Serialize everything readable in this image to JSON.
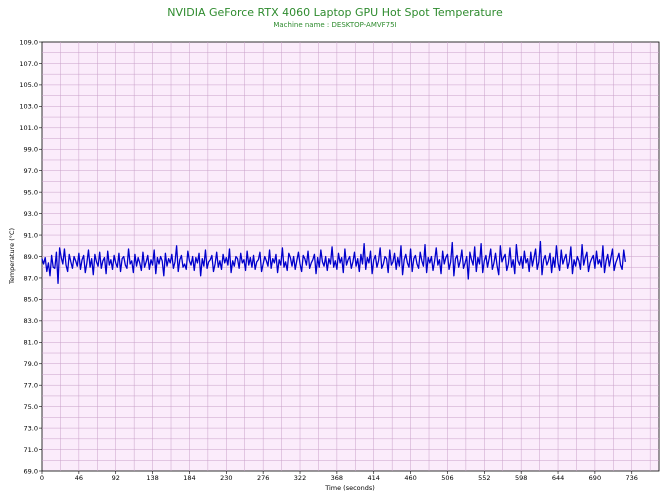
{
  "chart_data": {
    "type": "line",
    "title": "NVIDIA GeForce RTX 4060 Laptop GPU Hot Spot Temperature",
    "subtitle": "Machine name : DESKTOP-AMVF75I",
    "xlabel": "Time (seconds)",
    "ylabel": "Temperature (°C)",
    "xlim": [
      0,
      770
    ],
    "ylim": [
      69.0,
      109.0
    ],
    "x_ticks": [
      "0",
      "46",
      "92",
      "138",
      "184",
      "230",
      "276",
      "322",
      "368",
      "414",
      "460",
      "506",
      "552",
      "598",
      "644",
      "690",
      "736"
    ],
    "y_ticks": [
      "69.0",
      "71.0",
      "73.0",
      "75.0",
      "77.0",
      "79.0",
      "81.0",
      "83.0",
      "85.0",
      "87.0",
      "89.0",
      "91.0",
      "93.0",
      "95.0",
      "97.0",
      "99.0",
      "101.0",
      "103.0",
      "105.0",
      "107.0",
      "109.0"
    ],
    "grid": true,
    "series": [
      {
        "color": "#0000cc",
        "x_start": 0,
        "x_step": 2,
        "values": [
          88.8,
          88.3,
          88.9,
          87.6,
          88.4,
          87.2,
          89.1,
          88.0,
          87.9,
          89.4,
          86.5,
          89.8,
          88.9,
          88.3,
          89.7,
          88.2,
          87.6,
          89.2,
          88.5,
          87.9,
          89.0,
          88.6,
          88.1,
          89.3,
          87.8,
          88.7,
          89.1,
          87.5,
          88.4,
          89.6,
          88.0,
          88.8,
          87.3,
          89.2,
          88.5,
          88.1,
          89.4,
          87.9,
          88.6,
          88.9,
          87.4,
          89.5,
          88.2,
          88.7,
          87.8,
          89.1,
          88.4,
          88.0,
          89.3,
          87.6,
          88.8,
          89.0,
          88.2,
          87.9,
          89.7,
          88.3,
          88.6,
          87.5,
          89.2,
          88.1,
          88.9,
          88.4,
          87.7,
          89.4,
          88.0,
          88.5,
          89.1,
          87.8,
          88.7,
          88.2,
          89.6,
          87.4,
          88.9,
          88.3,
          89.0,
          88.6,
          87.2,
          89.3,
          88.1,
          88.8,
          88.4,
          89.2,
          87.9,
          88.5,
          90.0,
          87.6,
          88.7,
          89.1,
          88.0,
          88.3,
          87.8,
          89.5,
          88.6,
          88.2,
          89.0,
          87.7,
          88.9,
          88.4,
          89.3,
          87.2,
          88.8,
          88.1,
          89.6,
          87.9,
          88.5,
          88.7,
          89.1,
          87.6,
          88.3,
          89.4,
          88.0,
          88.6,
          87.8,
          89.2,
          88.4,
          88.9,
          88.2,
          89.7,
          87.5,
          88.6,
          88.1,
          89.0,
          88.8,
          87.9,
          89.3,
          88.4,
          88.7,
          87.7,
          89.5,
          88.2,
          88.9,
          88.0,
          89.1,
          87.8,
          88.5,
          88.7,
          89.4,
          87.6,
          88.3,
          89.0,
          88.6,
          88.1,
          89.6,
          87.9,
          88.8,
          88.4,
          89.2,
          87.5,
          88.7,
          88.2,
          89.8,
          88.0,
          88.5,
          87.7,
          89.3,
          88.9,
          88.1,
          89.0,
          87.8,
          88.6,
          89.4,
          88.3,
          87.6,
          89.1,
          88.8,
          88.2,
          89.5,
          87.9,
          88.4,
          88.7,
          89.2,
          87.4,
          88.9,
          88.0,
          89.6,
          88.5,
          88.1,
          89.0,
          87.7,
          88.8,
          88.3,
          89.9,
          88.0,
          88.6,
          87.8,
          89.3,
          88.4,
          88.9,
          87.5,
          89.7,
          88.2,
          88.7,
          89.0,
          87.9,
          88.5,
          89.4,
          88.1,
          88.8,
          87.6,
          89.2,
          88.3,
          90.2,
          87.8,
          88.9,
          88.4,
          89.5,
          87.4,
          88.7,
          89.1,
          88.0,
          88.6,
          89.8,
          87.9,
          88.3,
          89.0,
          88.8,
          87.5,
          89.6,
          88.2,
          88.5,
          89.3,
          87.8,
          88.9,
          88.1,
          90.0,
          87.3,
          88.7,
          89.2,
          88.4,
          88.0,
          89.7,
          87.6,
          88.8,
          89.1,
          88.3,
          87.9,
          89.4,
          88.6,
          88.1,
          90.1,
          87.5,
          88.9,
          88.4,
          89.0,
          87.7,
          88.6,
          89.8,
          88.2,
          88.7,
          87.4,
          89.5,
          88.3,
          88.9,
          89.2,
          87.8,
          88.5,
          90.3,
          87.2,
          88.8,
          89.1,
          88.0,
          88.6,
          89.6,
          87.9,
          88.4,
          89.0,
          86.9,
          89.4,
          88.7,
          88.2,
          89.9,
          87.6,
          88.9,
          88.3,
          90.2,
          87.5,
          88.6,
          89.1,
          88.0,
          88.8,
          89.7,
          87.8,
          88.4,
          89.3,
          88.1,
          87.3,
          90.0,
          88.5,
          88.9,
          89.2,
          87.7,
          88.3,
          89.8,
          88.0,
          88.7,
          87.4,
          90.1,
          88.6,
          88.2,
          89.0,
          87.9,
          89.5,
          88.4,
          88.8,
          87.6,
          89.4,
          88.1,
          88.9,
          89.7,
          87.8,
          88.5,
          90.4,
          87.3,
          88.7,
          89.1,
          88.2,
          88.6,
          89.3,
          87.5,
          88.9,
          88.0,
          90.0,
          88.4,
          87.7,
          89.6,
          88.3,
          88.8,
          89.2,
          87.9,
          88.5,
          89.9,
          87.4,
          88.7,
          88.1,
          89.0,
          88.6,
          87.8,
          90.1,
          88.2,
          88.9,
          89.4,
          87.6,
          88.4,
          88.8,
          89.1,
          87.9,
          89.5,
          88.3,
          88.7,
          88.0,
          90.0,
          87.5,
          88.6,
          89.2,
          88.1,
          88.9,
          89.7,
          87.7,
          88.4,
          88.8,
          89.3,
          88.2,
          87.8,
          89.6,
          88.5
        ]
      }
    ]
  }
}
